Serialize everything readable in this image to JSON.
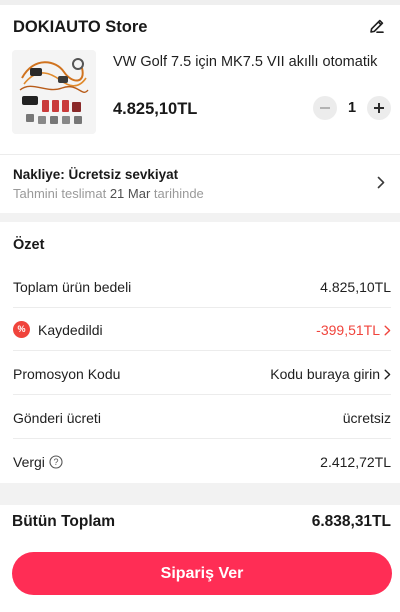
{
  "store": {
    "name": "DOKIAUTO Store",
    "edit_icon": "pencil-icon"
  },
  "product": {
    "title": "VW Golf 7.5 için MK7.5 VII akıllı otomatik",
    "price": "4.825,10TL",
    "quantity": "1",
    "image_icon": "wiring-harness-image"
  },
  "shipping": {
    "label": "Nakliye:",
    "value": "Ücretsiz sevkiyat",
    "estimate_prefix": "Tahmini teslimat",
    "estimate_date": "21 Mar",
    "estimate_suffix": "tarihinde"
  },
  "summary": {
    "title": "Özet",
    "rows": [
      {
        "label": "Toplam ürün bedeli",
        "value": "4.825,10TL"
      },
      {
        "label": "Kaydedildi",
        "value": "-399,51TL",
        "badge": "%"
      },
      {
        "label": "Promosyon Kodu",
        "value": "Kodu buraya girin"
      },
      {
        "label": "Gönderi ücreti",
        "value": "ücretsiz"
      },
      {
        "label": "Vergi",
        "value": "2.412,72TL"
      }
    ]
  },
  "total": {
    "label": "Bütün Toplam",
    "value": "6.838,31TL"
  },
  "order_button": {
    "label": "Sipariş Ver"
  },
  "colors": {
    "accent": "#ff2d55",
    "discount": "#f0443c",
    "muted": "#9a9a9a"
  }
}
